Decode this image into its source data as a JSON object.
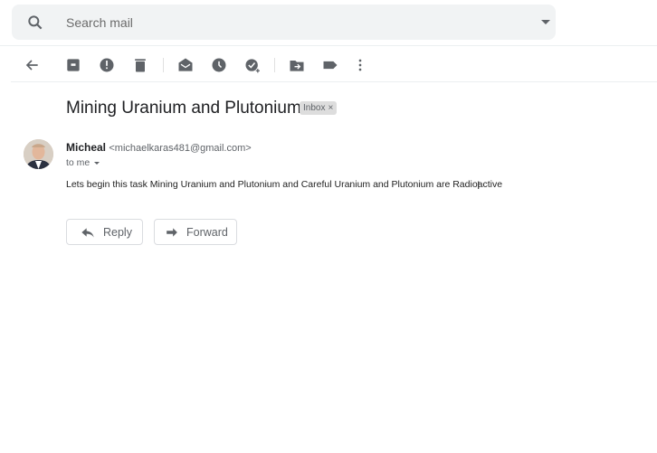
{
  "search": {
    "placeholder": "Search mail"
  },
  "toolbar": {
    "icons": [
      "back-arrow-icon",
      "archive-icon",
      "report-spam-icon",
      "delete-icon",
      "mark-unread-icon",
      "snooze-icon",
      "add-to-tasks-icon",
      "move-to-icon",
      "labels-icon",
      "more-icon"
    ]
  },
  "email": {
    "subject": "Mining Uranium and Plutonium",
    "label": "Inbox",
    "label_remove": "×",
    "sender_name": "Micheal",
    "sender_email": "<michaelkaras481@gmail.com>",
    "recipient": "to me",
    "body": "Lets begin this task Mining Uranium and Plutonium and Careful Uranium and Plutonium are Radioactive"
  },
  "actions": {
    "reply": "Reply",
    "forward": "Forward"
  }
}
